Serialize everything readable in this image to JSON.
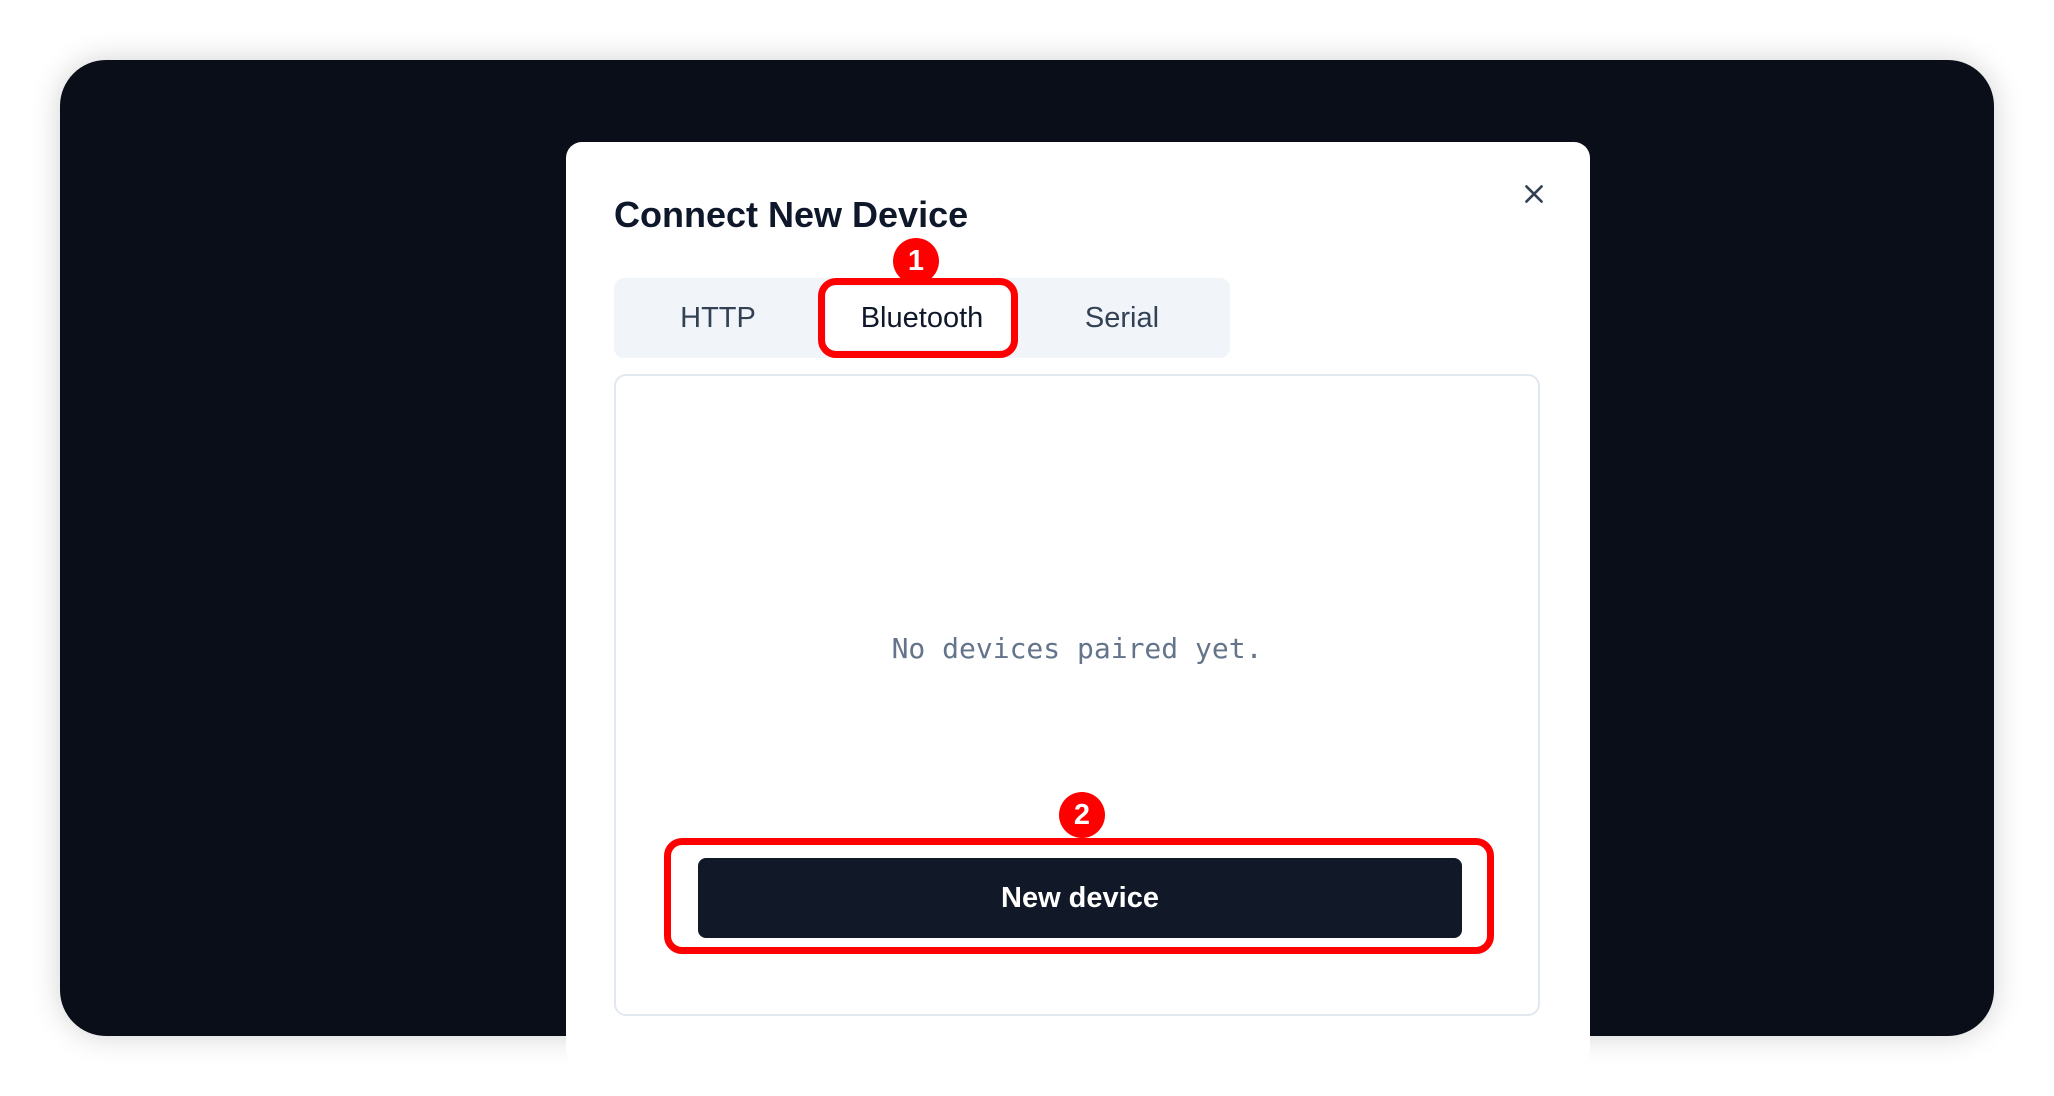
{
  "modal": {
    "title": "Connect New Device",
    "close_icon": "close-icon"
  },
  "tabs": [
    {
      "label": "HTTP",
      "selected": false
    },
    {
      "label": "Bluetooth",
      "selected": true
    },
    {
      "label": "Serial",
      "selected": false
    }
  ],
  "panel": {
    "empty_message": "No devices paired yet.",
    "new_device_label": "New device"
  },
  "annotations": {
    "highlight_color": "#ff0000",
    "badges": [
      "1",
      "2"
    ]
  },
  "colors": {
    "backdrop": "#0a0e18",
    "button_bg": "#111827",
    "tabbar_bg": "#f1f5f9"
  }
}
